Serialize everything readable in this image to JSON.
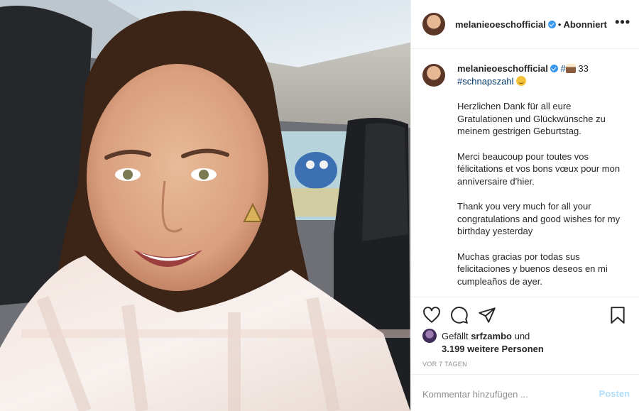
{
  "post": {
    "username": "melanieoeschofficial",
    "follow_state": "Abonniert",
    "separator": "•",
    "more_label": "•••"
  },
  "caption": {
    "username": "melanieoeschofficial",
    "headline_hash": "#",
    "headline_number": " 33",
    "hashtag": "#schnapszahl",
    "paragraphs": [
      "Herzlichen Dank für all eure Gratulationen und Glückwünsche zu meinem gestrigen Geburtstag.",
      "Merci beaucoup pour toutes vos félicitations et vos bons vœux pour mon anniversaire d'hier.",
      "Thank you very much for all your congratulations and good wishes for my birthday yesterday",
      "Muchas gracias por todas sus felicitaciones y buenos deseos en mi cumpleaños de ayer."
    ]
  },
  "likes": {
    "prefix": "Gefällt ",
    "liker": "srfzambo",
    "conjunction": " und",
    "others": "3.199 weitere Personen"
  },
  "timestamp": "VOR 7 TAGEN",
  "comment": {
    "placeholder": "Kommentar hinzufügen ...",
    "post_label": "Posten"
  },
  "icons": [
    "heart-icon",
    "comment-icon",
    "share-icon",
    "bookmark-icon",
    "verified-icon",
    "more-icon"
  ],
  "colors": {
    "accent_link": "#00376b",
    "verified": "#3897f0",
    "muted": "#8e8e8e",
    "post_button_disabled": "#b2dffc"
  }
}
